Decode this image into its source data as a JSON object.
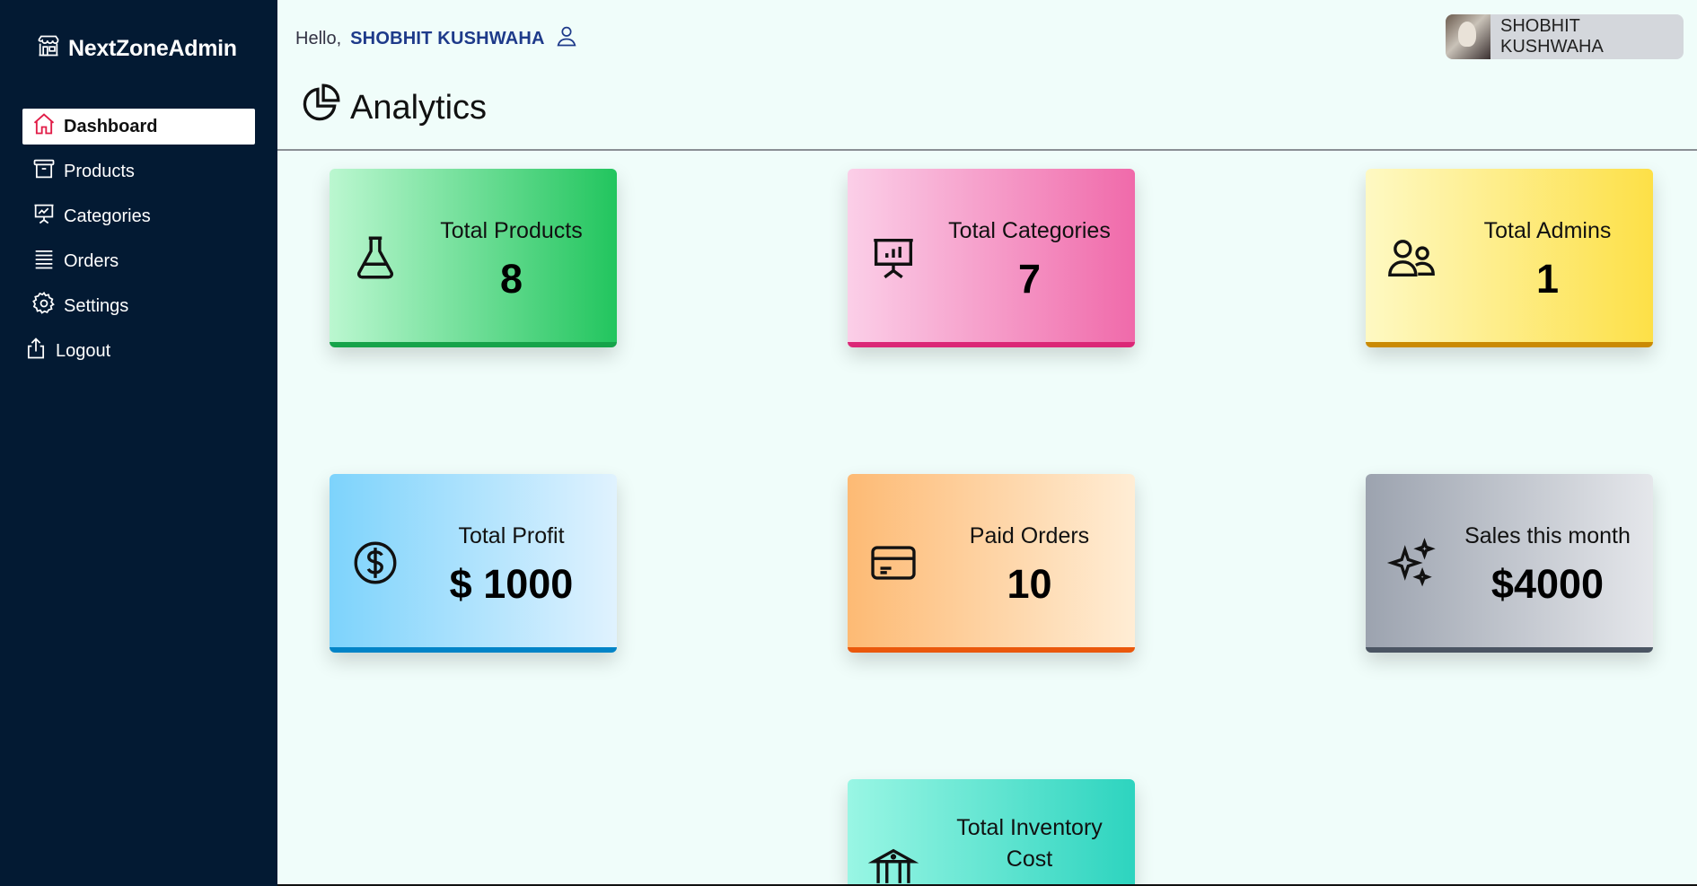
{
  "sidebar": {
    "brand": "NextZoneAdmin",
    "items": [
      {
        "label": "Dashboard",
        "icon": "home-icon",
        "active": true
      },
      {
        "label": "Products",
        "icon": "archive-box-icon"
      },
      {
        "label": "Categories",
        "icon": "presentation-chart-icon"
      },
      {
        "label": "Orders",
        "icon": "list-icon"
      },
      {
        "label": "Settings",
        "icon": "gear-icon"
      },
      {
        "label": "Logout",
        "icon": "share-upload-icon"
      }
    ]
  },
  "header": {
    "greeting": "Hello,",
    "username": "SHOBHIT KUSHWAHA",
    "page_title": "Analytics",
    "profile_name": "SHOBHIT KUSHWAHA"
  },
  "cards": [
    {
      "title": "Total Products",
      "value": "8",
      "icon": "beaker-icon",
      "color": "#22c55e"
    },
    {
      "title": "Total Categories",
      "value": "7",
      "icon": "presentation-chart-icon",
      "color": "#f06aaa"
    },
    {
      "title": "Total Admins",
      "value": "1",
      "icon": "users-icon",
      "color": "#fde047"
    },
    {
      "title": "Total Profit",
      "value": "$ 1000",
      "icon": "dollar-circle-icon",
      "color": "#7dd3fc"
    },
    {
      "title": "Paid Orders",
      "value": "10",
      "icon": "credit-card-icon",
      "color": "#fdba74"
    },
    {
      "title": "Sales this month",
      "value": "$4000",
      "icon": "sparkles-icon",
      "color": "#9ca3af"
    },
    {
      "title_line1": "Total Inventory",
      "title_line2": "Cost",
      "icon": "bank-icon",
      "color": "#2dd4bf"
    }
  ]
}
